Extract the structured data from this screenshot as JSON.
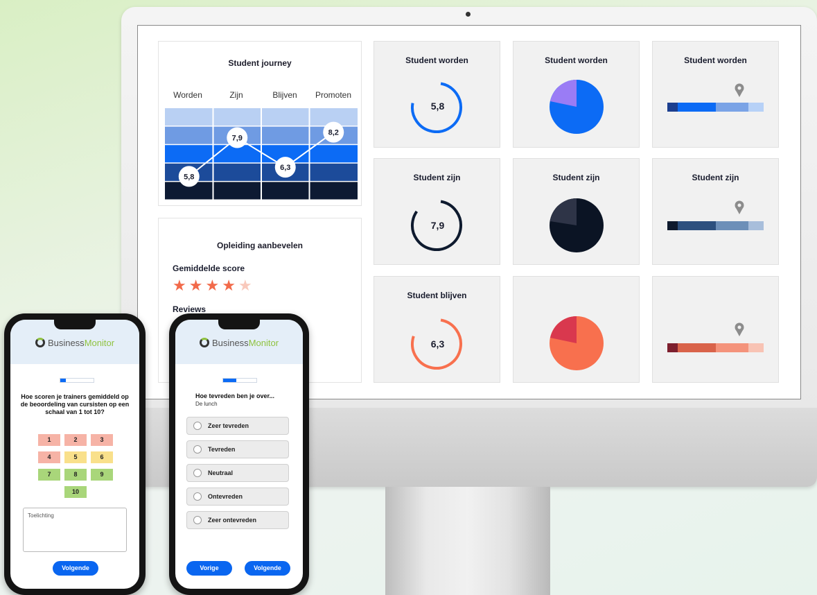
{
  "journey": {
    "title": "Student journey",
    "stages": [
      "Worden",
      "Zijn",
      "Blijven",
      "Promoten"
    ],
    "scores": [
      "5,8",
      "7,9",
      "6,3",
      "8,2"
    ],
    "score_values": [
      5.8,
      7.9,
      6.3,
      8.2
    ]
  },
  "recommend": {
    "title": "Opleiding aanbevelen",
    "avg_label": "Gemiddelde score",
    "rating": 4,
    "rating_max": 5,
    "reviews_label": "Reviews"
  },
  "tiles": {
    "row1_title": "Student worden",
    "row2_title": "Student zijn",
    "row3_title": "Student blijven",
    "row1_score": "5,8",
    "row2_score": "7,9",
    "row3_score": "6,3"
  },
  "colors": {
    "blue": "#0c6bf5",
    "navy": "#0e1a2e",
    "coral": "#f8704e",
    "purple": "#9a7cf5"
  },
  "phone1": {
    "brand_a": "Business",
    "brand_b": "Monitor",
    "question": "Hoe scoren je trainers gemiddeld op de beoordeling van cursisten op een schaal van 1 tot 10?",
    "numbers": [
      "1",
      "2",
      "3",
      "4",
      "5",
      "6",
      "7",
      "8",
      "9",
      "10"
    ],
    "comment_placeholder": "Toelichting",
    "next_label": "Volgende"
  },
  "phone2": {
    "brand_a": "Business",
    "brand_b": "Monitor",
    "question": "Hoe tevreden ben je over...",
    "subject": "De lunch",
    "options": [
      "Zeer tevreden",
      "Tevreden",
      "Neutraal",
      "Ontevreden",
      "Zeer ontevreden"
    ],
    "prev_label": "Vorige",
    "next_label": "Volgende"
  }
}
